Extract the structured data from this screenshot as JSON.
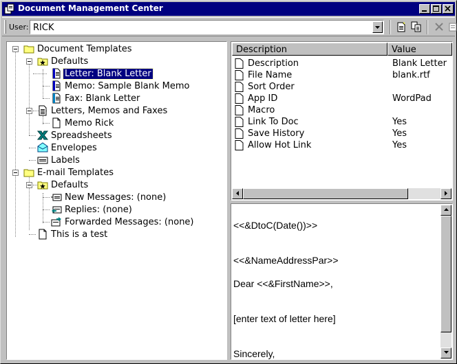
{
  "window": {
    "title": "Document Management Center"
  },
  "toolbar": {
    "user_label": "User:",
    "user_value": "RICK",
    "icons": [
      "new-document-icon",
      "copy-document-icon",
      "delete-icon",
      "properties-icon"
    ]
  },
  "tree": {
    "nodes": [
      {
        "label": "Document Templates",
        "icon": "folder-icon"
      },
      {
        "label": "Defaults",
        "icon": "folder-star-icon"
      },
      {
        "label": "Letter: Blank Letter",
        "icon": "word-document-icon"
      },
      {
        "label": "Memo: Sample Blank Memo",
        "icon": "word-document-icon"
      },
      {
        "label": "Fax: Blank Letter",
        "icon": "word-document-icon"
      },
      {
        "label": "Letters, Memos and Faxes",
        "icon": "document-icon"
      },
      {
        "label": "Memo Rick",
        "icon": "page-icon"
      },
      {
        "label": "Spreadsheets",
        "icon": "excel-icon"
      },
      {
        "label": "Envelopes",
        "icon": "envelope-icon"
      },
      {
        "label": "Labels",
        "icon": "label-icon"
      },
      {
        "label": "E-mail Templates",
        "icon": "folder-icon"
      },
      {
        "label": "Defaults",
        "icon": "folder-star-icon"
      },
      {
        "label": "New Messages: (none)",
        "icon": "new-message-icon"
      },
      {
        "label": "Replies: (none)",
        "icon": "reply-icon"
      },
      {
        "label": "Forwarded Messages: (none)",
        "icon": "forward-icon"
      },
      {
        "label": "This is a test",
        "icon": "page-icon"
      }
    ],
    "selected": "Letter: Blank Letter"
  },
  "list": {
    "columns": [
      "Description",
      "Value"
    ],
    "rows": [
      {
        "desc": "Description",
        "value": "Blank Letter"
      },
      {
        "desc": "File Name",
        "value": "blank.rtf"
      },
      {
        "desc": "Sort Order",
        "value": ""
      },
      {
        "desc": "App ID",
        "value": "WordPad"
      },
      {
        "desc": "Macro",
        "value": ""
      },
      {
        "desc": "Link To Doc",
        "value": "Yes"
      },
      {
        "desc": "Save History",
        "value": "Yes"
      },
      {
        "desc": "Allow Hot Link",
        "value": "Yes"
      }
    ]
  },
  "document": {
    "lines": [
      "<<&DtoC(Date())>>",
      "<<&NameAddressPar>>",
      "Dear <<&FirstName>>,",
      "[enter text of letter here]",
      "Sincerely,"
    ]
  },
  "colors": {
    "titlebar": "#000080",
    "selection": "#000080",
    "face": "#c0c0c0"
  }
}
